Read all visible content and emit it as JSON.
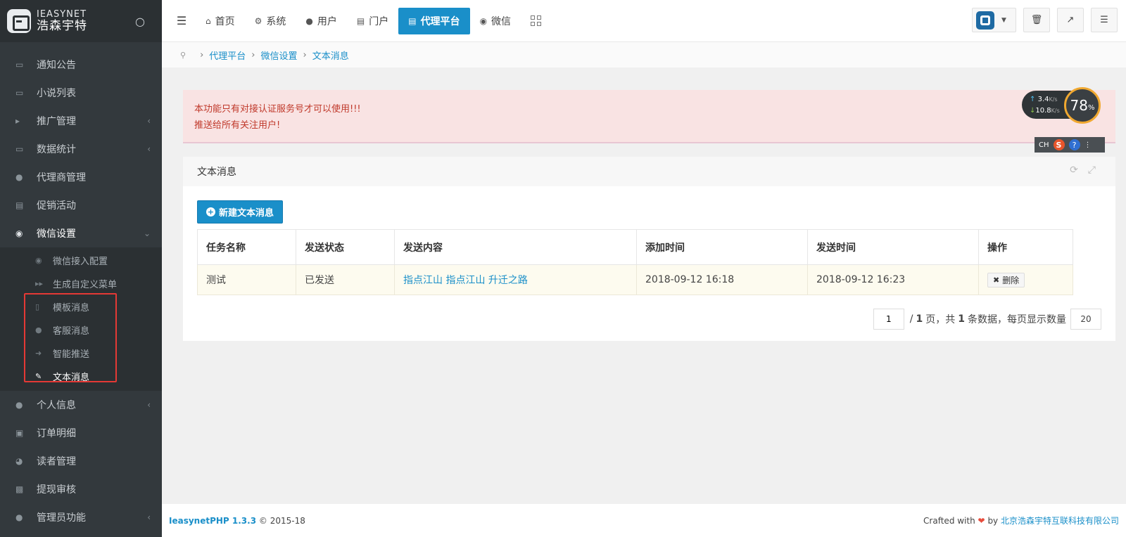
{
  "app": {
    "brand_en": "IEASYNET",
    "brand_cn": "浩森宇特"
  },
  "sidebar": {
    "items": [
      {
        "label": "通知公告",
        "icon": "folder-icon"
      },
      {
        "label": "小说列表",
        "icon": "folder-icon"
      },
      {
        "label": "推广管理",
        "icon": "bullhorn-icon",
        "has_arrow": true
      },
      {
        "label": "数据统计",
        "icon": "folder-icon",
        "has_arrow": true
      },
      {
        "label": "代理商管理",
        "icon": "users-icon"
      },
      {
        "label": "促销活动",
        "icon": "coffee-icon"
      },
      {
        "label": "微信设置",
        "icon": "wechat-icon",
        "open": true
      },
      {
        "label": "个人信息",
        "icon": "user-icon",
        "has_arrow": true
      },
      {
        "label": "订单明细",
        "icon": "cart-icon"
      },
      {
        "label": "读者管理",
        "icon": "headphones-icon"
      },
      {
        "label": "提现审核",
        "icon": "money-icon"
      },
      {
        "label": "管理员功能",
        "icon": "user-icon",
        "has_arrow": true
      }
    ],
    "submenu": [
      {
        "label": "微信接入配置",
        "icon": "wechat-icon"
      },
      {
        "label": "生成自定义菜单",
        "icon": "forward-icon"
      },
      {
        "label": "模板消息",
        "icon": "file-icon"
      },
      {
        "label": "客服消息",
        "icon": "user-icon"
      },
      {
        "label": "智能推送",
        "icon": "sign-out-icon"
      },
      {
        "label": "文本消息",
        "icon": "edit-icon",
        "active": true
      }
    ]
  },
  "topnav": {
    "tabs": [
      {
        "label": "首页",
        "icon": "home-icon"
      },
      {
        "label": "系统",
        "icon": "gear-icon"
      },
      {
        "label": "用户",
        "icon": "user-icon"
      },
      {
        "label": "门户",
        "icon": "newspaper-icon"
      },
      {
        "label": "代理平台",
        "icon": "newspaper-icon",
        "active": true
      },
      {
        "label": "微信",
        "icon": "wechat-icon"
      }
    ]
  },
  "breadcrumb": {
    "items": [
      "代理平台",
      "微信设置",
      "文本消息"
    ]
  },
  "alert": {
    "line1": "本功能只有对接认证服务号才可以使用!!!",
    "line2": "推送给所有关注用户!"
  },
  "panel": {
    "title": "文本消息",
    "new_button": "新建文本消息",
    "columns": [
      "任务名称",
      "发送状态",
      "发送内容",
      "添加时间",
      "发送时间",
      "操作"
    ],
    "rows": [
      {
        "name": "测试",
        "status": "已发送",
        "content": "指点江山 指点江山 升迁之路",
        "added": "2018-09-12 16:18",
        "sent": "2018-09-12 16:23",
        "action": "删除"
      }
    ],
    "pager": {
      "page_value": "1",
      "total_pages": "1",
      "page_unit": "页，共",
      "total_records": "1",
      "records_unit": "条数据，每页显示数量",
      "page_size": "20"
    }
  },
  "footer": {
    "brand": "IeasynetPHP 1.3.3",
    "copyright": "© 2015-18",
    "crafted": "Crafted with",
    "by": "by",
    "company": "北京浩森宇特互联科技有限公司"
  },
  "speed_widget": {
    "up": "3.4",
    "down": "10.8",
    "unit": "K/s",
    "percent": "78",
    "percent_unit": "%",
    "ime": "CH"
  },
  "colors": {
    "accent": "#1a8fc9",
    "sidebar_bg": "#33393d",
    "alert_bg": "#f9e3e3",
    "alert_text": "#c0392b",
    "highlight": "#e53935"
  }
}
